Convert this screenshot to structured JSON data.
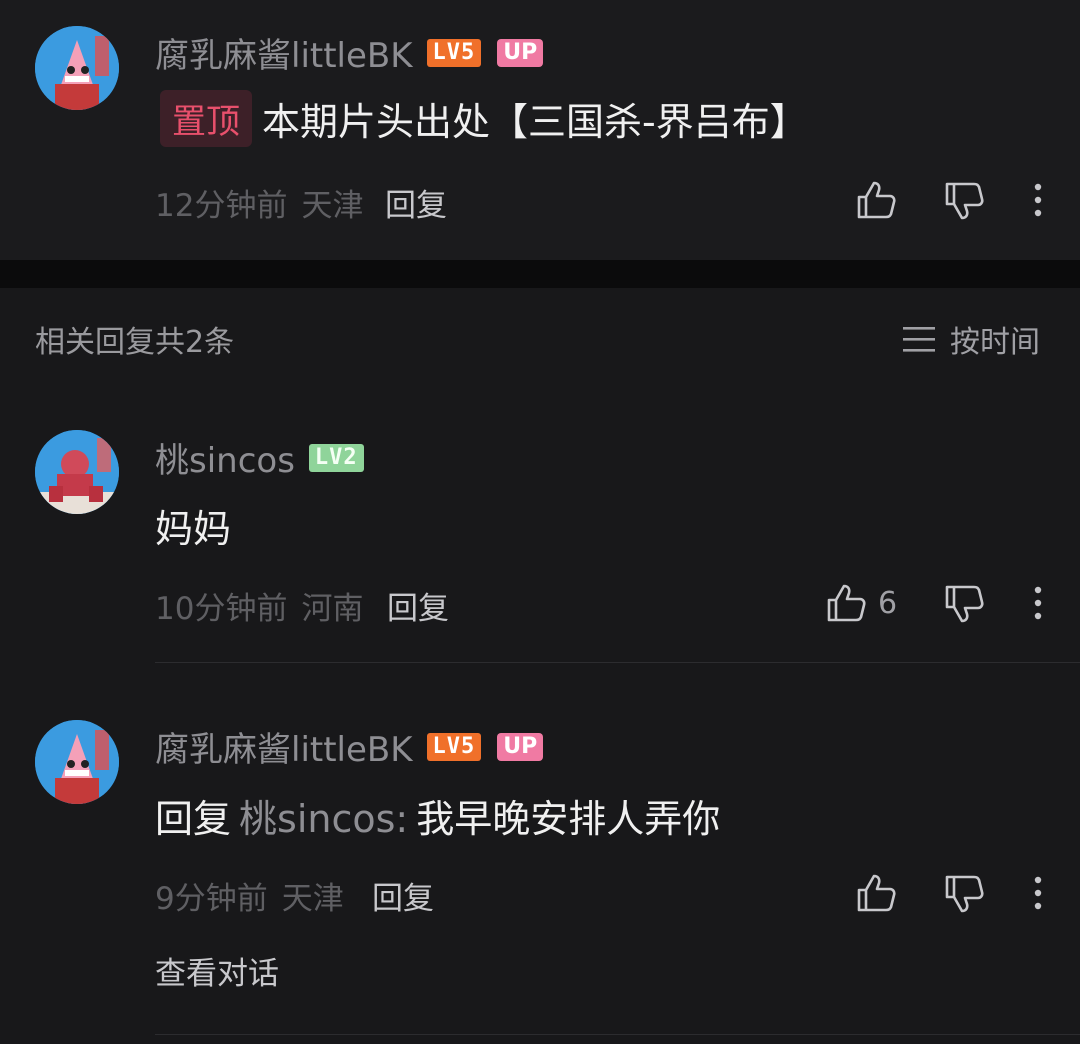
{
  "top_comment": {
    "username": "腐乳麻酱littleBK",
    "level": "LV5",
    "up_badge": "UP",
    "pin_label": "置顶",
    "content": "本期片头出处【三国杀-界吕布】",
    "time": "12分钟前",
    "location": "天津",
    "reply_label": "回复"
  },
  "replies_header": {
    "title": "相关回复共2条",
    "sort_label": "按时间"
  },
  "replies": [
    {
      "username": "桃sincos",
      "level": "LV2",
      "content": "妈妈",
      "time": "10分钟前",
      "location": "河南",
      "reply_label": "回复",
      "like_count": "6"
    },
    {
      "username": "腐乳麻酱littleBK",
      "level": "LV5",
      "up_badge": "UP",
      "reply_prefix": "回复",
      "mention": "桃sincos:",
      "content": "我早晚安排人弄你",
      "time": "9分钟前",
      "location": "天津",
      "reply_label": "回复",
      "view_conversation": "查看对话"
    }
  ],
  "icons": {
    "like": "thumb-up-icon",
    "dislike": "thumb-down-icon",
    "more": "more-vertical-icon",
    "sort": "menu-lines-icon"
  },
  "colors": {
    "background": "#18181a",
    "lv5": "#f0702a",
    "lv2": "#8fd49a",
    "up_badge": "#f07aa3",
    "pin_text": "#e8506c"
  }
}
